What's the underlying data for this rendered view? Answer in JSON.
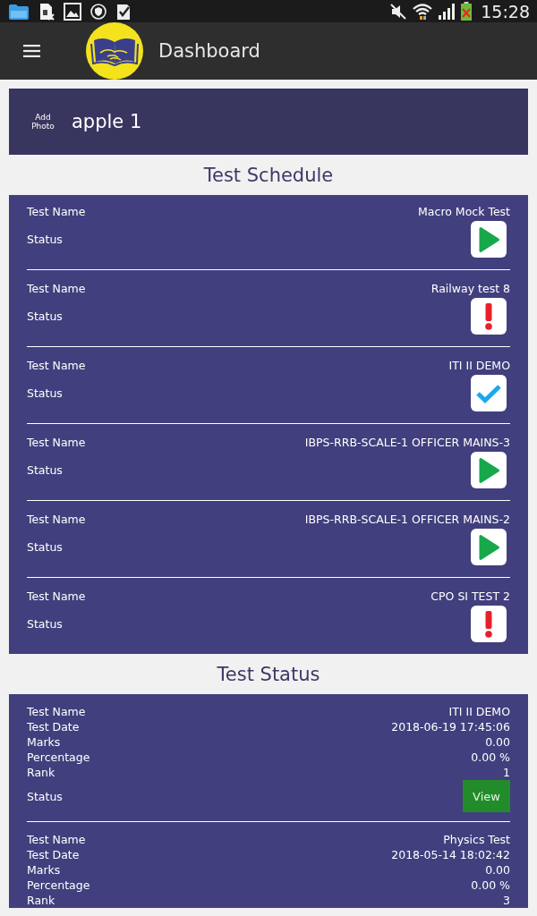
{
  "status_bar": {
    "time": "15:28"
  },
  "app_bar": {
    "title": "Dashboard"
  },
  "profile": {
    "photo_label": "Add Photo",
    "name": "apple 1"
  },
  "test_schedule": {
    "title": "Test Schedule",
    "items": [
      {
        "name_label": "Test Name",
        "name": "Macro Mock Test",
        "status_label": "Status",
        "kind": "play"
      },
      {
        "name_label": "Test Name",
        "name": "Railway test 8",
        "status_label": "Status",
        "kind": "alert"
      },
      {
        "name_label": "Test Name",
        "name": "ITI II DEMO",
        "status_label": "Status",
        "kind": "done"
      },
      {
        "name_label": "Test Name",
        "name": "IBPS-RRB-SCALE-1 OFFICER MAINS-3",
        "status_label": "Status",
        "kind": "play"
      },
      {
        "name_label": "Test Name",
        "name": "IBPS-RRB-SCALE-1 OFFICER MAINS-2",
        "status_label": "Status",
        "kind": "play"
      },
      {
        "name_label": "Test Name",
        "name": "CPO SI TEST 2",
        "status_label": "Status",
        "kind": "alert"
      }
    ]
  },
  "test_status": {
    "title": "Test Status",
    "items": [
      {
        "fields": [
          {
            "label": "Test Name",
            "value": "ITI II DEMO"
          },
          {
            "label": "Test Date",
            "value": "2018-06-19 17:45:06"
          },
          {
            "label": "Marks",
            "value": "0.00"
          },
          {
            "label": "Percentage",
            "value": "0.00 %"
          },
          {
            "label": "Rank",
            "value": "1"
          }
        ],
        "status_label": "Status",
        "action": "View"
      },
      {
        "fields": [
          {
            "label": "Test Name",
            "value": "Physics Test"
          },
          {
            "label": "Test Date",
            "value": "2018-05-14 18:02:42"
          },
          {
            "label": "Marks",
            "value": "0.00"
          },
          {
            "label": "Percentage",
            "value": "0.00 %"
          },
          {
            "label": "Rank",
            "value": "3"
          }
        ]
      }
    ]
  }
}
